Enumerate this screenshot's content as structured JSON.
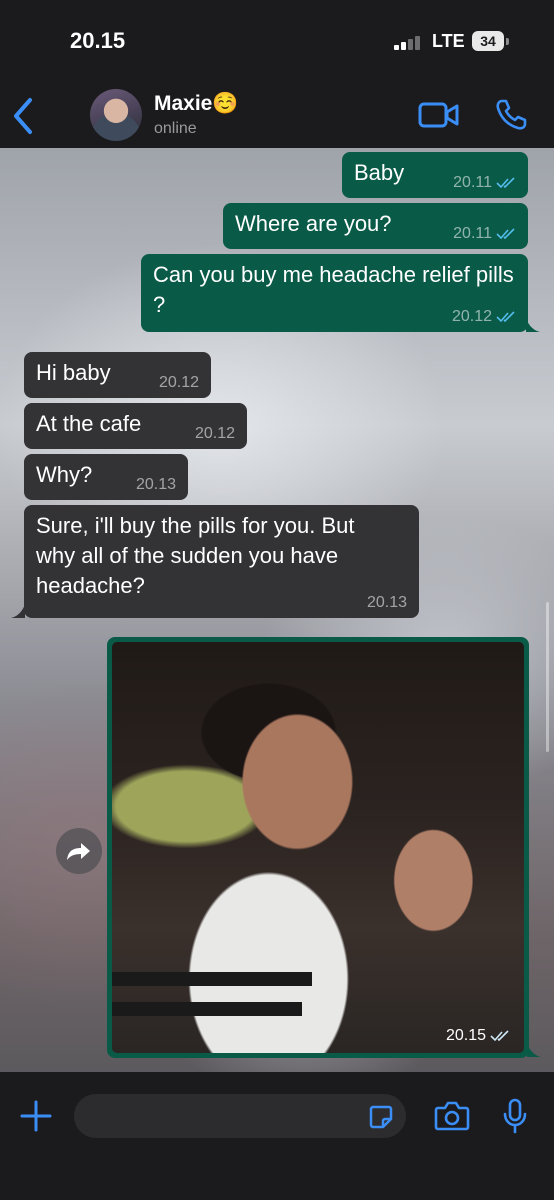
{
  "status_bar": {
    "time": "20.15",
    "network": "LTE",
    "battery": "34"
  },
  "header": {
    "contact_name": "Maxie☺️",
    "contact_status": "online"
  },
  "colors": {
    "accent": "#3a8ef6",
    "outgoing_bubble": "#0a5a48",
    "incoming_bubble": "#333336",
    "read_ticks": "#53bdeb"
  },
  "messages": [
    {
      "direction": "out",
      "text": "Baby",
      "time": "20.11"
    },
    {
      "direction": "out",
      "text": "Where are you?",
      "time": "20.11"
    },
    {
      "direction": "out",
      "text": "Can you buy me headache relief pills ?",
      "time": "20.12"
    },
    {
      "direction": "in",
      "text": "Hi baby",
      "time": "20.12"
    },
    {
      "direction": "in",
      "text": "At the cafe",
      "time": "20.12"
    },
    {
      "direction": "in",
      "text": "Why?",
      "time": "20.13"
    },
    {
      "direction": "in",
      "text": "Sure, i'll buy the pills for you. But why all of the sudden you have headache?",
      "time": "20.13"
    },
    {
      "direction": "out",
      "type": "photo",
      "time": "20.15"
    }
  ],
  "input_bar": {
    "placeholder": ""
  },
  "icons": [
    "back-chevron-icon",
    "video-call-icon",
    "phone-icon",
    "forward-icon",
    "plus-icon",
    "sticker-icon",
    "camera-icon",
    "microphone-icon",
    "double-check-icon"
  ]
}
